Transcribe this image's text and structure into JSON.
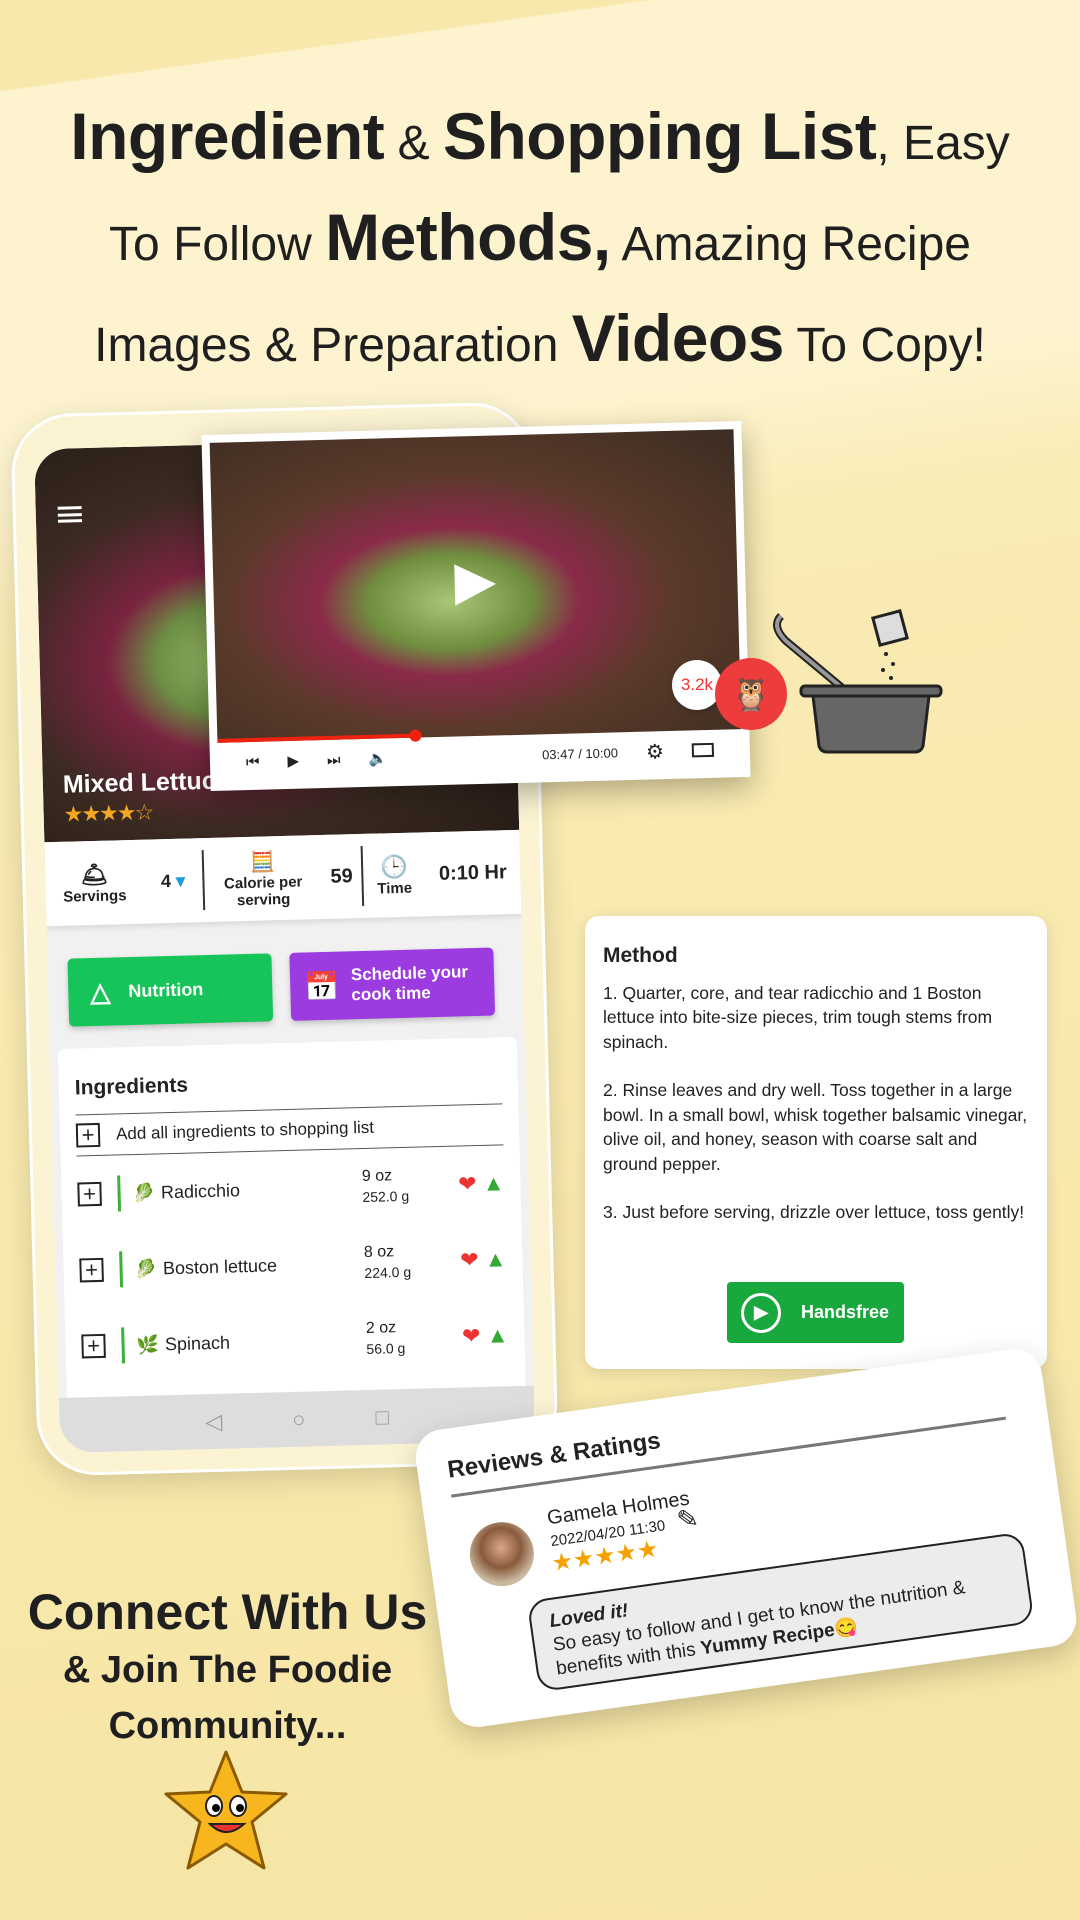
{
  "headline": {
    "l1a": "Ingredient",
    "l1b": " & ",
    "l1c": "Shopping List",
    ",l1d": "",
    "l1e": ", Easy",
    "l2a": "To Follow ",
    "l2b": "Methods,",
    "l2c": " Amazing Recipe",
    "l3a": "Images & Preparation ",
    "l3b": "Videos",
    "l3c": " To Copy!"
  },
  "recipe": {
    "title": "Mixed Lettuce",
    "rating": "★★★★☆"
  },
  "info": {
    "servings_label": "Servings",
    "servings_value": "4",
    "calorie_label": "Calorie per serving",
    "calorie_value": "59",
    "time_label": "Time",
    "time_value": "0:10 Hr"
  },
  "buttons": {
    "nutrition": "Nutrition",
    "schedule": "Schedule your cook time",
    "handsfree": "Handsfree"
  },
  "ingredients": {
    "title": "Ingredients",
    "add_all": "Add all ingredients to shopping list",
    "items": [
      {
        "name": "Radicchio",
        "oz": "9 oz",
        "g": "252.0 g"
      },
      {
        "name": "Boston lettuce",
        "oz": "8 oz",
        "g": "224.0 g"
      },
      {
        "name": "Spinach",
        "oz": "2 oz",
        "g": "56.0 g"
      }
    ]
  },
  "video": {
    "time": "03:47 / 10:00",
    "progress": 0.378
  },
  "badge": {
    "count": "3.2k"
  },
  "method": {
    "title": "Method",
    "steps": [
      "1. Quarter, core, and tear radicchio and 1 Boston lettuce into bite-size pieces, trim tough stems from spinach.",
      "2. Rinse leaves and dry well. Toss together in a large bowl. In a small bowl, whisk together balsamic vinegar, olive oil, and honey, season with coarse salt and ground pepper.",
      "3. Just before serving, drizzle over lettuce, toss gently!"
    ]
  },
  "review": {
    "title": "Reviews & Ratings",
    "name": "Gamela Holmes",
    "date": "2022/04/20 11:30",
    "stars": "★★★★★",
    "headline": "Loved it!",
    "text": "So easy to follow and I get to know the nutrition & benefits with this ",
    "bold": "Yummy Recipe",
    "emoji": "😋"
  },
  "connect": {
    "l1": "Connect With Us",
    "l2": "& Join The Foodie",
    "l3": "Community..."
  },
  "colors": {
    "green": "#19a83e",
    "purple": "#9b3be0",
    "red": "#ee3b3b",
    "star": "#f5a623"
  }
}
